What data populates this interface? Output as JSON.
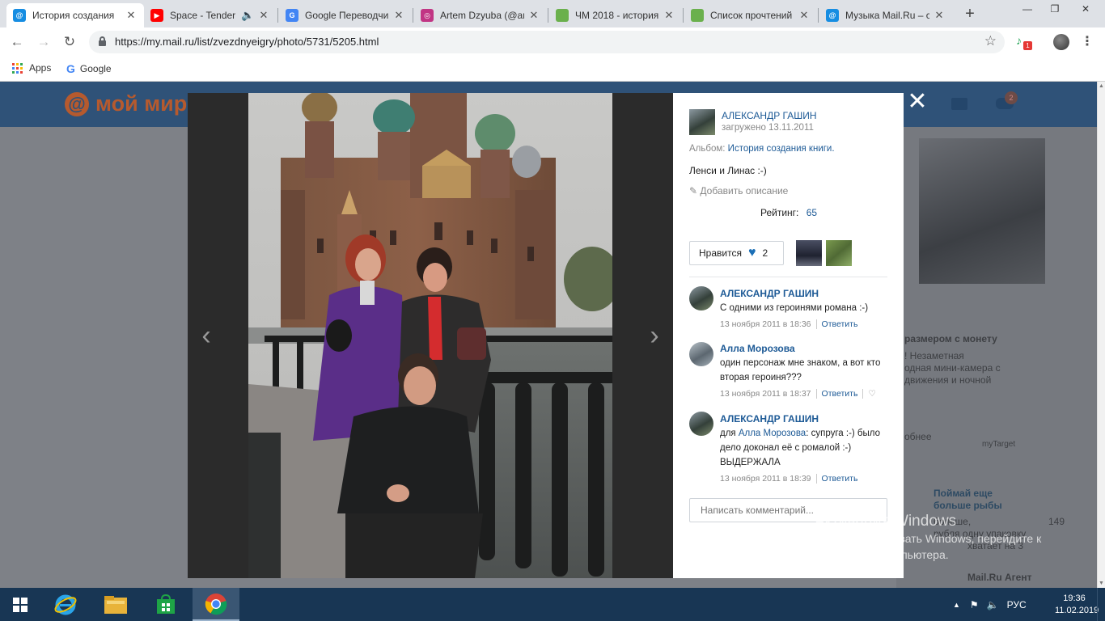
{
  "browser": {
    "tabs": [
      {
        "title": "История создания",
        "icon": "mail-ru-icon",
        "favicon_color": "#168de2",
        "active": true,
        "extra": ""
      },
      {
        "title": "Space - Tender",
        "icon": "youtube-icon",
        "favicon_color": "#ff0000",
        "active": false,
        "extra": "audio"
      },
      {
        "title": "Google Переводчик",
        "icon": "google-translate-icon",
        "favicon_color": "#4285f4",
        "active": false,
        "extra": ""
      },
      {
        "title": "Artem Dzyuba (@ar",
        "icon": "instagram-icon",
        "favicon_color": "#c13584",
        "active": false,
        "extra": ""
      },
      {
        "title": "ЧМ 2018 - история",
        "icon": "green-square-icon",
        "favicon_color": "#6ab04c",
        "active": false,
        "extra": ""
      },
      {
        "title": "Список прочтений",
        "icon": "green-square-icon",
        "favicon_color": "#6ab04c",
        "active": false,
        "extra": ""
      },
      {
        "title": "Музыка Mail.Ru – с",
        "icon": "mail-ru-icon",
        "favicon_color": "#168de2",
        "active": false,
        "extra": ""
      }
    ],
    "new_tab_label": "+",
    "window_controls": {
      "minimize": "—",
      "maximize": "❐",
      "close": "✕"
    },
    "url": "https://my.mail.ru/list/zvezdnyeigry/photo/5731/5205.html",
    "extension_badge": "1",
    "bookmarks": [
      {
        "label": "Apps",
        "icon": "apps-grid-icon"
      },
      {
        "label": "Google",
        "icon": "google-icon"
      }
    ]
  },
  "site": {
    "logo_text": "мой мир",
    "logo_symbol": "@",
    "games_badge": "2"
  },
  "background_ad": {
    "heading": "размером с монету",
    "lines": [
      "! Незаметная",
      "одная мини-камера с",
      "движения и ночной"
    ],
    "button_label": "обнее",
    "target_label": "myTarget",
    "promo_title": [
      "Поймай еще",
      "больше рыбы"
    ],
    "promo_lines": [
      "больше,",
      "149",
      "рубля одну упаковку",
      "хватает на 3"
    ],
    "agent_label": "Mail.Ru Агент"
  },
  "photo_panel": {
    "author": "АЛЕКСАНДР ГАШИН",
    "uploaded": "загружено 13.11.2011",
    "album_label": "Альбом:",
    "album_name": "История создания книги.",
    "caption": "Ленси и Линас :-)",
    "add_description": "Добавить описание",
    "rating_label": "Рейтинг:",
    "rating_value": "65",
    "like_label": "Нравится",
    "like_count": "2",
    "comments": [
      {
        "author": "АЛЕКСАНДР ГАШИН",
        "text": "С одними из героинями романа :-)",
        "date": "13 ноября 2011 в 18:36",
        "reply": "Ответить",
        "mention": "",
        "text_after": ""
      },
      {
        "author": "Алла Морозова",
        "text": "один персонаж мне знаком, а вот кто вторая героиня???",
        "date": "13 ноября 2011 в 18:37",
        "reply": "Ответить",
        "mention": "",
        "text_after": ""
      },
      {
        "author": "АЛЕКСАНДР ГАШИН",
        "text": "для ",
        "date": "13 ноября 2011 в 18:39",
        "reply": "Ответить",
        "mention": "Алла Морозова",
        "text_after": ": супруга :-) было дело доконал её с ромалой :-) ВЫДЕРЖАЛА"
      }
    ],
    "comment_placeholder": "Написать комментарий..."
  },
  "watermark": {
    "title": "Активация Windows",
    "line1": "Чтобы активировать Windows, перейдите к",
    "line2": "параметрам компьютера."
  },
  "taskbar": {
    "apps": [
      "windows-start-icon",
      "internet-explorer-icon",
      "file-explorer-icon",
      "windows-store-icon",
      "chrome-icon"
    ],
    "language": "РУС",
    "time": "19:36",
    "date": "11.02.2019"
  },
  "colors": {
    "accent_link": "#1d5a96",
    "site_header": "#2f5278",
    "like_heart": "#1b6fb6",
    "taskbar": "#183654"
  }
}
